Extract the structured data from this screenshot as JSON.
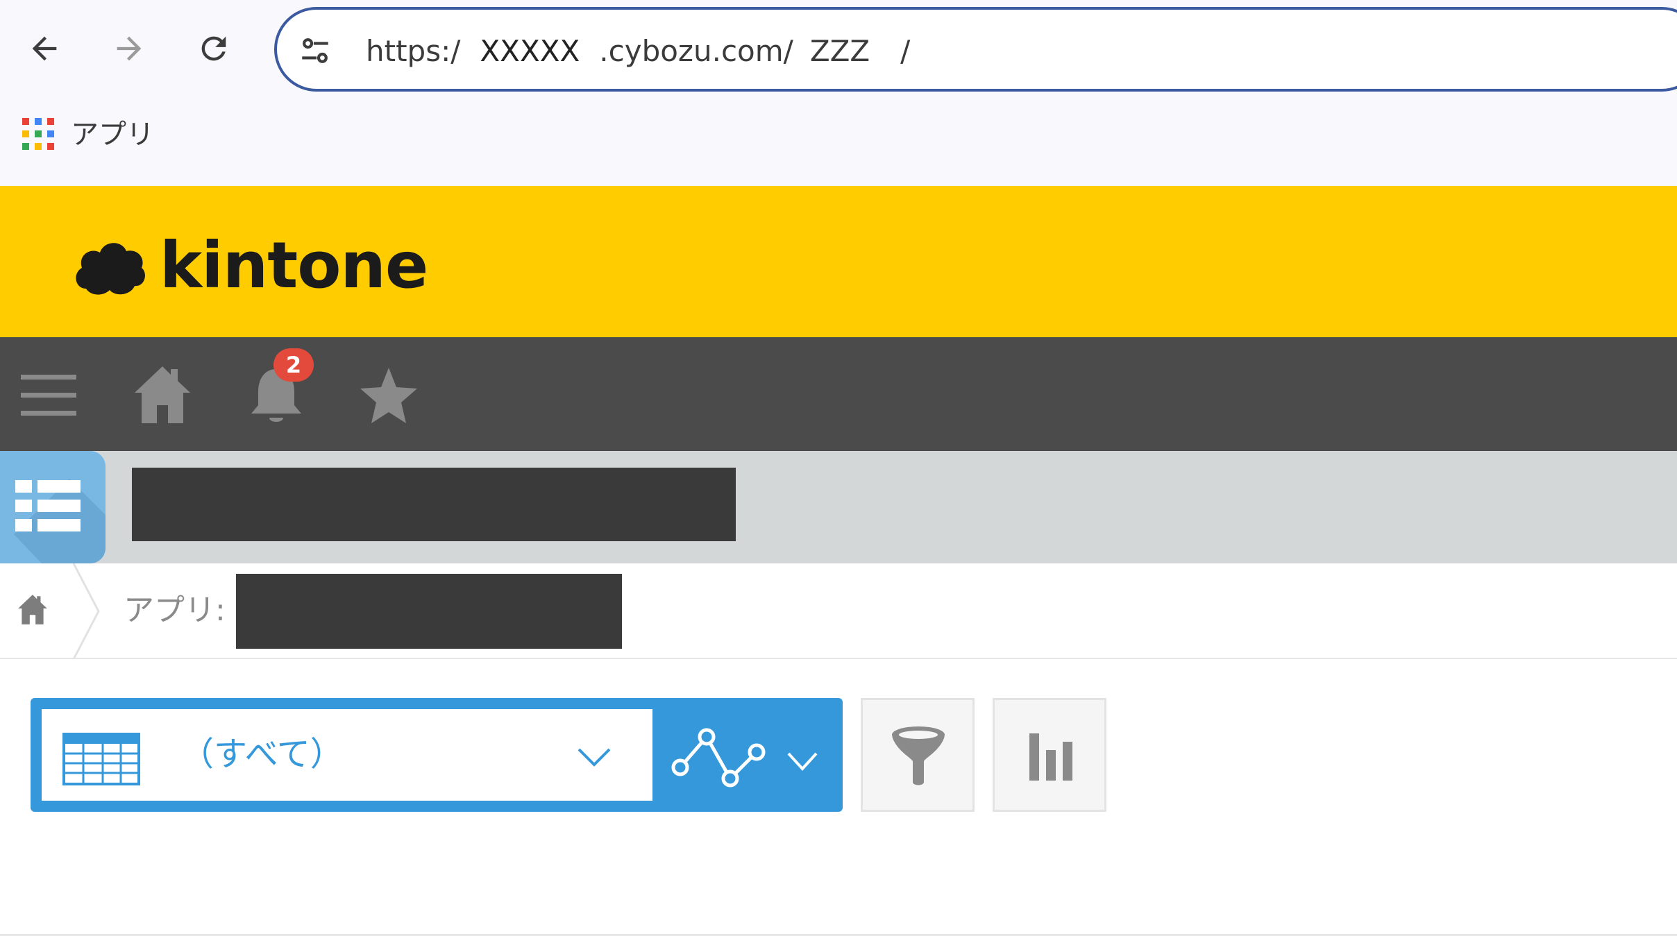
{
  "browser": {
    "url_scheme": "https:/",
    "url_host_part": "XXXXX",
    "url_domain": ".cybozu.com/",
    "url_path": "ZZZ",
    "url_tail": "/",
    "bookmark_apps_label": "アプリ"
  },
  "header": {
    "brand": "kintone",
    "brand_color": "#ffcc00"
  },
  "global_nav": {
    "notification_count": "2",
    "icons": [
      "menu-icon",
      "home-icon",
      "bell-icon",
      "star-icon"
    ]
  },
  "breadcrumb": {
    "app_label": "アプリ:"
  },
  "view": {
    "selected_view": "（すべて）",
    "accent_color": "#3598db"
  },
  "colors": {
    "app_icon_bg": "#79b8e3",
    "dark_nav_bg": "#4b4b4b",
    "badge_red": "#e34a3c"
  }
}
